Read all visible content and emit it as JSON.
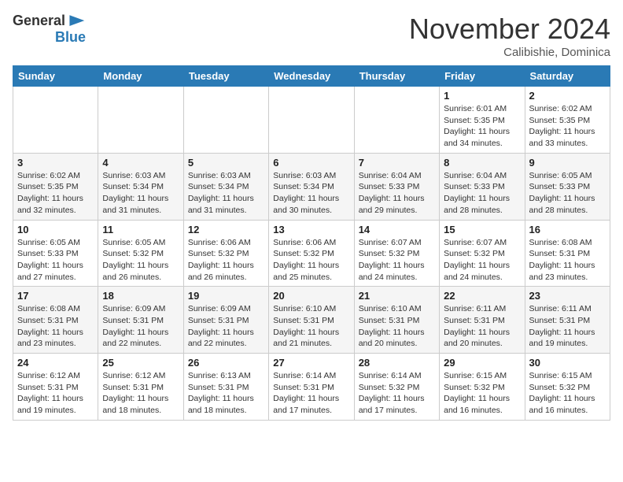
{
  "header": {
    "logo_line1": "General",
    "logo_line2": "Blue",
    "month": "November 2024",
    "location": "Calibishie, Dominica"
  },
  "weekdays": [
    "Sunday",
    "Monday",
    "Tuesday",
    "Wednesday",
    "Thursday",
    "Friday",
    "Saturday"
  ],
  "weeks": [
    [
      {
        "day": "",
        "info": ""
      },
      {
        "day": "",
        "info": ""
      },
      {
        "day": "",
        "info": ""
      },
      {
        "day": "",
        "info": ""
      },
      {
        "day": "",
        "info": ""
      },
      {
        "day": "1",
        "info": "Sunrise: 6:01 AM\nSunset: 5:35 PM\nDaylight: 11 hours\nand 34 minutes."
      },
      {
        "day": "2",
        "info": "Sunrise: 6:02 AM\nSunset: 5:35 PM\nDaylight: 11 hours\nand 33 minutes."
      }
    ],
    [
      {
        "day": "3",
        "info": "Sunrise: 6:02 AM\nSunset: 5:35 PM\nDaylight: 11 hours\nand 32 minutes."
      },
      {
        "day": "4",
        "info": "Sunrise: 6:03 AM\nSunset: 5:34 PM\nDaylight: 11 hours\nand 31 minutes."
      },
      {
        "day": "5",
        "info": "Sunrise: 6:03 AM\nSunset: 5:34 PM\nDaylight: 11 hours\nand 31 minutes."
      },
      {
        "day": "6",
        "info": "Sunrise: 6:03 AM\nSunset: 5:34 PM\nDaylight: 11 hours\nand 30 minutes."
      },
      {
        "day": "7",
        "info": "Sunrise: 6:04 AM\nSunset: 5:33 PM\nDaylight: 11 hours\nand 29 minutes."
      },
      {
        "day": "8",
        "info": "Sunrise: 6:04 AM\nSunset: 5:33 PM\nDaylight: 11 hours\nand 28 minutes."
      },
      {
        "day": "9",
        "info": "Sunrise: 6:05 AM\nSunset: 5:33 PM\nDaylight: 11 hours\nand 28 minutes."
      }
    ],
    [
      {
        "day": "10",
        "info": "Sunrise: 6:05 AM\nSunset: 5:33 PM\nDaylight: 11 hours\nand 27 minutes."
      },
      {
        "day": "11",
        "info": "Sunrise: 6:05 AM\nSunset: 5:32 PM\nDaylight: 11 hours\nand 26 minutes."
      },
      {
        "day": "12",
        "info": "Sunrise: 6:06 AM\nSunset: 5:32 PM\nDaylight: 11 hours\nand 26 minutes."
      },
      {
        "day": "13",
        "info": "Sunrise: 6:06 AM\nSunset: 5:32 PM\nDaylight: 11 hours\nand 25 minutes."
      },
      {
        "day": "14",
        "info": "Sunrise: 6:07 AM\nSunset: 5:32 PM\nDaylight: 11 hours\nand 24 minutes."
      },
      {
        "day": "15",
        "info": "Sunrise: 6:07 AM\nSunset: 5:32 PM\nDaylight: 11 hours\nand 24 minutes."
      },
      {
        "day": "16",
        "info": "Sunrise: 6:08 AM\nSunset: 5:31 PM\nDaylight: 11 hours\nand 23 minutes."
      }
    ],
    [
      {
        "day": "17",
        "info": "Sunrise: 6:08 AM\nSunset: 5:31 PM\nDaylight: 11 hours\nand 23 minutes."
      },
      {
        "day": "18",
        "info": "Sunrise: 6:09 AM\nSunset: 5:31 PM\nDaylight: 11 hours\nand 22 minutes."
      },
      {
        "day": "19",
        "info": "Sunrise: 6:09 AM\nSunset: 5:31 PM\nDaylight: 11 hours\nand 22 minutes."
      },
      {
        "day": "20",
        "info": "Sunrise: 6:10 AM\nSunset: 5:31 PM\nDaylight: 11 hours\nand 21 minutes."
      },
      {
        "day": "21",
        "info": "Sunrise: 6:10 AM\nSunset: 5:31 PM\nDaylight: 11 hours\nand 20 minutes."
      },
      {
        "day": "22",
        "info": "Sunrise: 6:11 AM\nSunset: 5:31 PM\nDaylight: 11 hours\nand 20 minutes."
      },
      {
        "day": "23",
        "info": "Sunrise: 6:11 AM\nSunset: 5:31 PM\nDaylight: 11 hours\nand 19 minutes."
      }
    ],
    [
      {
        "day": "24",
        "info": "Sunrise: 6:12 AM\nSunset: 5:31 PM\nDaylight: 11 hours\nand 19 minutes."
      },
      {
        "day": "25",
        "info": "Sunrise: 6:12 AM\nSunset: 5:31 PM\nDaylight: 11 hours\nand 18 minutes."
      },
      {
        "day": "26",
        "info": "Sunrise: 6:13 AM\nSunset: 5:31 PM\nDaylight: 11 hours\nand 18 minutes."
      },
      {
        "day": "27",
        "info": "Sunrise: 6:14 AM\nSunset: 5:31 PM\nDaylight: 11 hours\nand 17 minutes."
      },
      {
        "day": "28",
        "info": "Sunrise: 6:14 AM\nSunset: 5:32 PM\nDaylight: 11 hours\nand 17 minutes."
      },
      {
        "day": "29",
        "info": "Sunrise: 6:15 AM\nSunset: 5:32 PM\nDaylight: 11 hours\nand 16 minutes."
      },
      {
        "day": "30",
        "info": "Sunrise: 6:15 AM\nSunset: 5:32 PM\nDaylight: 11 hours\nand 16 minutes."
      }
    ]
  ]
}
